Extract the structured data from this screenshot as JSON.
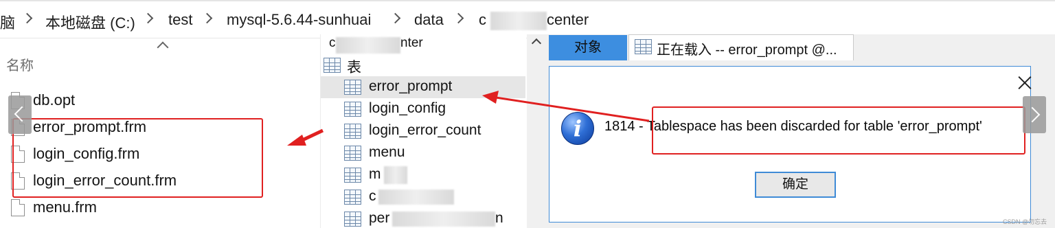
{
  "breadcrumb": {
    "items": [
      "脑",
      "本地磁盘 (C:)",
      "test",
      "mysql-5.6.44-sunhuai",
      "data",
      "c",
      "center"
    ]
  },
  "file_list": {
    "column_header": "名称",
    "files": [
      "db.opt",
      "error_prompt.frm",
      "login_config.frm",
      "login_error_count.frm",
      "menu.frm"
    ]
  },
  "object_tree": {
    "header_start": "c",
    "header_end": "nter",
    "group_label": "表",
    "tables": [
      "error_prompt",
      "login_config",
      "login_error_count",
      "menu",
      "m",
      "c",
      "per",
      "n"
    ]
  },
  "tabs": {
    "objects_label": "对象",
    "loading_label": "正在载入 -- error_prompt @..."
  },
  "dialog": {
    "message": "1814 - Tablespace has been discarded for table 'error_prompt'",
    "ok_label": "确定",
    "icon": "info-icon"
  },
  "watermark": "CSDN @勿忘去",
  "colors": {
    "annotation_red": "#e02020",
    "tab_selected": "#3d8ee0",
    "dialog_border": "#3e8ad6"
  }
}
